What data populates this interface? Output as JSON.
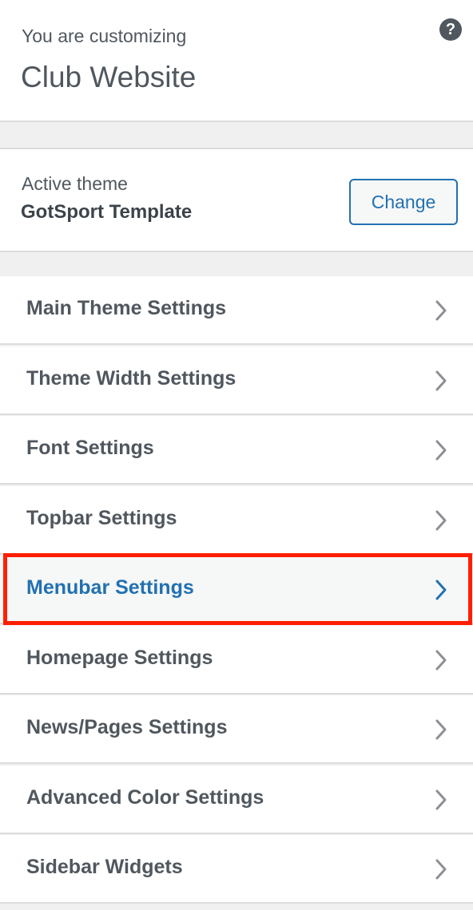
{
  "header": {
    "pretitle": "You are customizing",
    "title": "Club Website",
    "help_symbol": "?"
  },
  "theme": {
    "label": "Active theme",
    "name": "GotSport Template",
    "change_label": "Change"
  },
  "sections": [
    {
      "label": "Main Theme Settings",
      "active": false
    },
    {
      "label": "Theme Width Settings",
      "active": false
    },
    {
      "label": "Font Settings",
      "active": false
    },
    {
      "label": "Topbar Settings",
      "active": false
    },
    {
      "label": "Menubar Settings",
      "active": true
    },
    {
      "label": "Homepage Settings",
      "active": false
    },
    {
      "label": "News/Pages Settings",
      "active": false
    },
    {
      "label": "Advanced Color Settings",
      "active": false
    },
    {
      "label": "Sidebar Widgets",
      "active": false
    }
  ],
  "colors": {
    "accent": "#2271b1",
    "highlight_border": "#ff1f00",
    "text": "#50575e"
  },
  "icons": {
    "help": "help-icon",
    "chevron": "chevron-right-icon"
  }
}
